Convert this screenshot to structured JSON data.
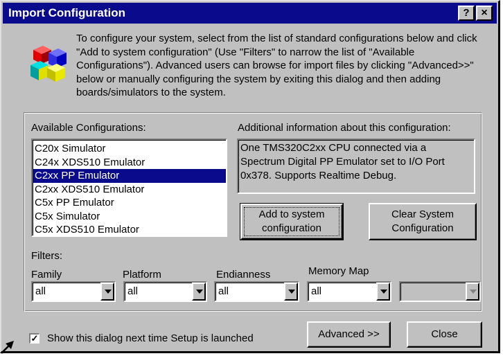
{
  "window": {
    "title": "Import Configuration",
    "help_button": "?",
    "close_button": "×"
  },
  "intro_text": "To configure your system, select from the list of standard configurations below and click \"Add to system configuration\" (Use \"Filters\" to narrow the list of \"Available Configurations\").  Advanced users can browse for import files by clicking \"Advanced>>\" below or manually configuring the system by exiting this dialog and then adding boards/simulators to the system.",
  "available": {
    "label": "Available Configurations:",
    "items": [
      {
        "label": "C20x Simulator",
        "selected": false
      },
      {
        "label": "C24x XDS510 Emulator",
        "selected": false
      },
      {
        "label": "C2xx PP Emulator",
        "selected": true
      },
      {
        "label": "C2xx XDS510 Emulator",
        "selected": false
      },
      {
        "label": "C5x  PP Emulator",
        "selected": false
      },
      {
        "label": "C5x Simulator",
        "selected": false
      },
      {
        "label": "C5x XDS510 Emulator",
        "selected": false
      }
    ]
  },
  "info": {
    "label": "Additional information about this configuration:",
    "text": "One TMS320C2xx CPU connected via a Spectrum Digital PP Emulator set to I/O Port 0x378. Supports Realtime Debug."
  },
  "buttons": {
    "add": {
      "line1": "Add to system",
      "line2": "configuration"
    },
    "clear": {
      "line1": "Clear System",
      "line2": "Configuration"
    },
    "advanced": "Advanced >>",
    "close": "Close"
  },
  "filters": {
    "label": "Filters:",
    "family": {
      "label": "Family",
      "value": "all"
    },
    "platform": {
      "label": "Platform",
      "value": "all"
    },
    "endianness": {
      "label": "Endianness",
      "value": "all"
    },
    "memory_map": {
      "label": "Memory Map",
      "value": "all"
    },
    "extra": {
      "value": ""
    }
  },
  "show_dialog": {
    "checked": true,
    "check_mark": "✓",
    "label": "Show this dialog next time Setup is launched"
  },
  "colors": {
    "title_bar": "#0a0a8c",
    "selection": "#0a0a8c",
    "face": "#c0c0c0"
  }
}
